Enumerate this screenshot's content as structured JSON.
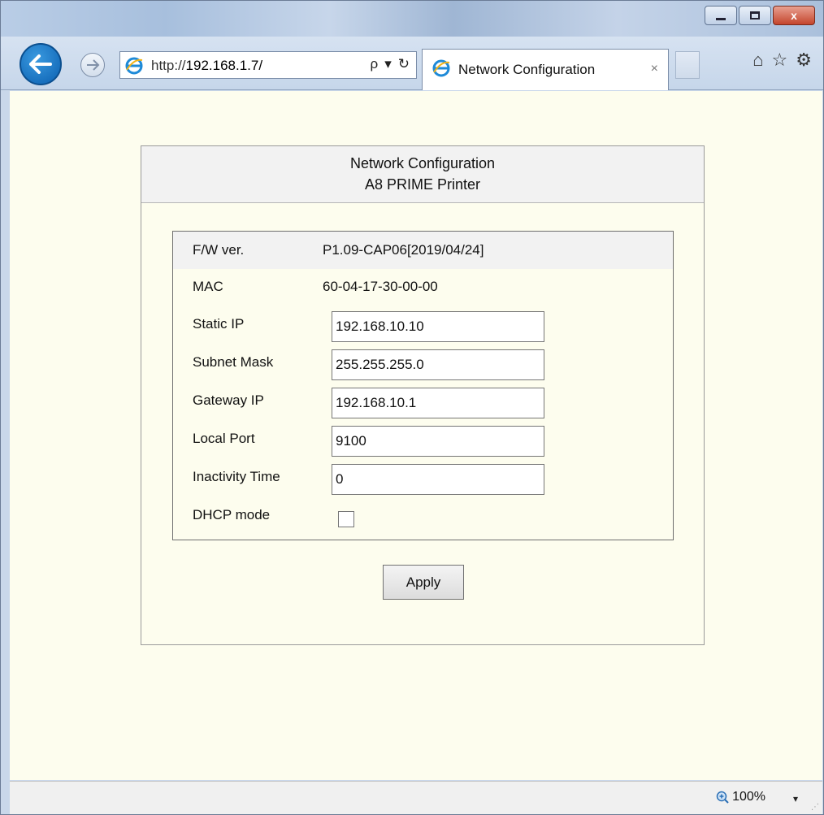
{
  "browser": {
    "url_prefix": "http://",
    "url_host": "192.168.1.7/",
    "tab_title": "Network Configuration",
    "tab_close": "×",
    "search_glyph": "ρ",
    "dropdown_glyph": "▾",
    "refresh_glyph": "↻",
    "zoom_level": "100%"
  },
  "window_controls": {
    "close_glyph": "x"
  },
  "panel": {
    "title": "Network Configuration",
    "subtitle": "A8 PRIME Printer"
  },
  "fields": {
    "fw_label": "F/W ver.",
    "fw_value": "P1.09-CAP06[2019/04/24]",
    "mac_label": "MAC",
    "mac_value": "60-04-17-30-00-00",
    "static_ip_label": "Static IP",
    "static_ip_value": "192.168.10.10",
    "subnet_label": "Subnet Mask",
    "subnet_value": "255.255.255.0",
    "gateway_label": "Gateway IP",
    "gateway_value": "192.168.10.1",
    "port_label": "Local Port",
    "port_value": "9100",
    "inactivity_label": "Inactivity Time",
    "inactivity_value": "0",
    "dhcp_label": "DHCP mode",
    "dhcp_checked": false
  },
  "actions": {
    "apply_label": "Apply"
  },
  "colors": {
    "page_background": "#fdfdee",
    "header_background": "#f2f2f2",
    "back_button": "#0a5fb0"
  }
}
